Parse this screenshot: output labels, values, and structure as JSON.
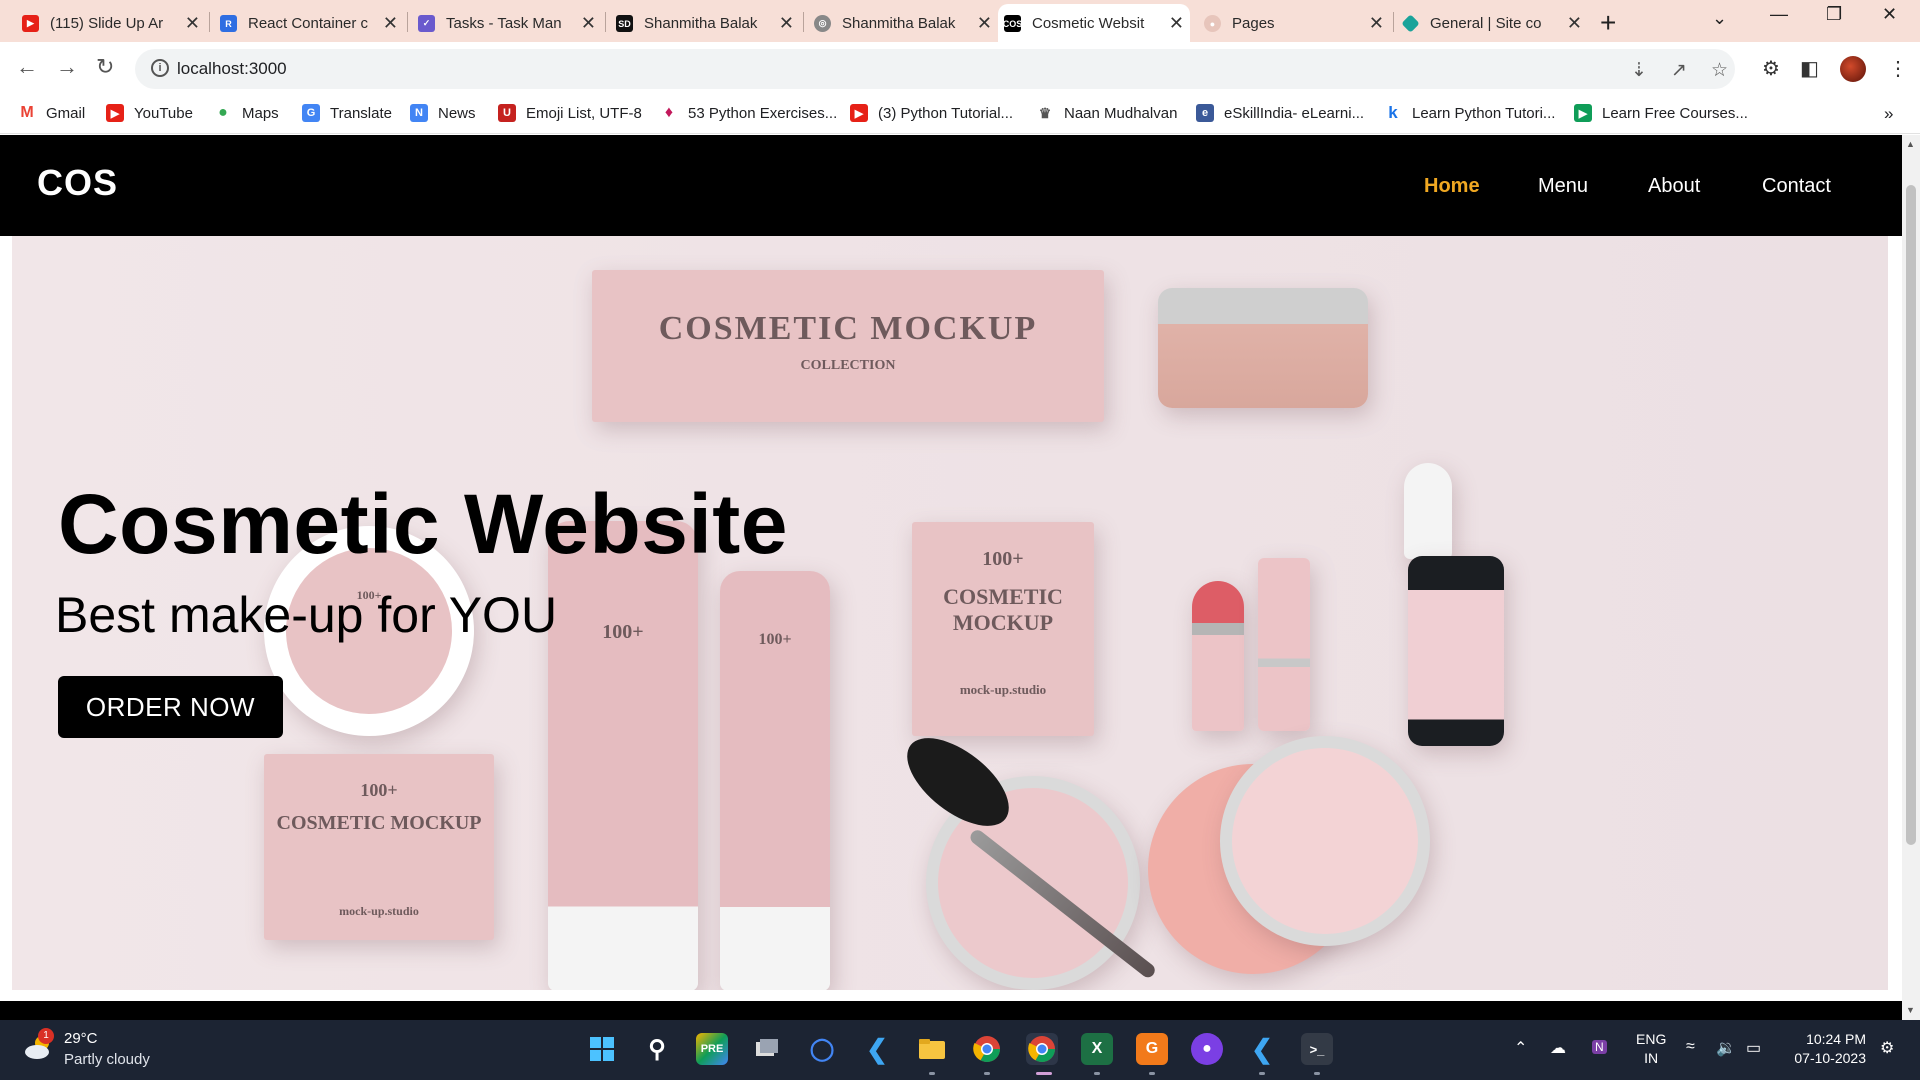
{
  "browser": {
    "tabs": [
      {
        "title": "(115) Slide Up Ar",
        "favicon": "youtube-icon",
        "color": "#e62117"
      },
      {
        "title": "React Container c",
        "favicon": "react-icon",
        "color": "#2f6ee2"
      },
      {
        "title": "Tasks - Task Man",
        "favicon": "task-icon",
        "color": "#6a5acd"
      },
      {
        "title": "Shanmitha Balak",
        "favicon": "sd-icon",
        "color": "#111111"
      },
      {
        "title": "Shanmitha Balak",
        "favicon": "globe-icon",
        "color": "#888888"
      },
      {
        "title": "Cosmetic Websit",
        "favicon": "cos-icon",
        "color": "#000000"
      },
      {
        "title": "Pages",
        "favicon": "github-icon",
        "color": "#e7c5bb"
      },
      {
        "title": "General | Site co",
        "favicon": "netlify-icon",
        "color": "#1aa39a"
      }
    ],
    "active_tab_index": 5,
    "url": "localhost:3000",
    "bookmarks": [
      {
        "label": "Gmail",
        "icon": "gmail-icon",
        "color": "#ea4335"
      },
      {
        "label": "YouTube",
        "icon": "youtube-icon",
        "color": "#e62117"
      },
      {
        "label": "Maps",
        "icon": "maps-icon",
        "color": "#34a853"
      },
      {
        "label": "Translate",
        "icon": "translate-icon",
        "color": "#4285f4"
      },
      {
        "label": "News",
        "icon": "news-icon",
        "color": "#4285f4"
      },
      {
        "label": "Emoji List, UTF-8",
        "icon": "emoji-icon",
        "color": "#c5221f"
      },
      {
        "label": "53 Python Exercises...",
        "icon": "gem-icon",
        "color": "#c2185b"
      },
      {
        "label": "(3) Python Tutorial...",
        "icon": "youtube-icon",
        "color": "#e62117"
      },
      {
        "label": "Naan Mudhalvan",
        "icon": "emblem-icon",
        "color": "#555555"
      },
      {
        "label": "eSkillIndia- eLearni...",
        "icon": "eskill-icon",
        "color": "#3b5998"
      },
      {
        "label": "Learn Python Tutori...",
        "icon": "k-icon",
        "color": "#1a73e8"
      },
      {
        "label": "Learn Free Courses...",
        "icon": "play-icon",
        "color": "#0f9d58"
      }
    ]
  },
  "site": {
    "logo": "COS",
    "nav": [
      "Home",
      "Menu",
      "About",
      "Contact"
    ],
    "active_nav": "Home",
    "accent_color": "#f0a822",
    "hero": {
      "title": "Cosmetic Website",
      "subtitle": "Best make-up for YOU",
      "cta": "ORDER NOW"
    },
    "product_text": {
      "brand_line": "COSMETIC MOCKUP",
      "count": "100+",
      "collection": "COLLECTION",
      "studio": "mock-up.studio"
    }
  },
  "taskbar": {
    "temperature": "29°C",
    "condition": "Partly cloudy",
    "weather_badge": "1",
    "language_line1": "ENG",
    "language_line2": "IN",
    "time": "10:24 PM",
    "date": "07-10-2023"
  }
}
